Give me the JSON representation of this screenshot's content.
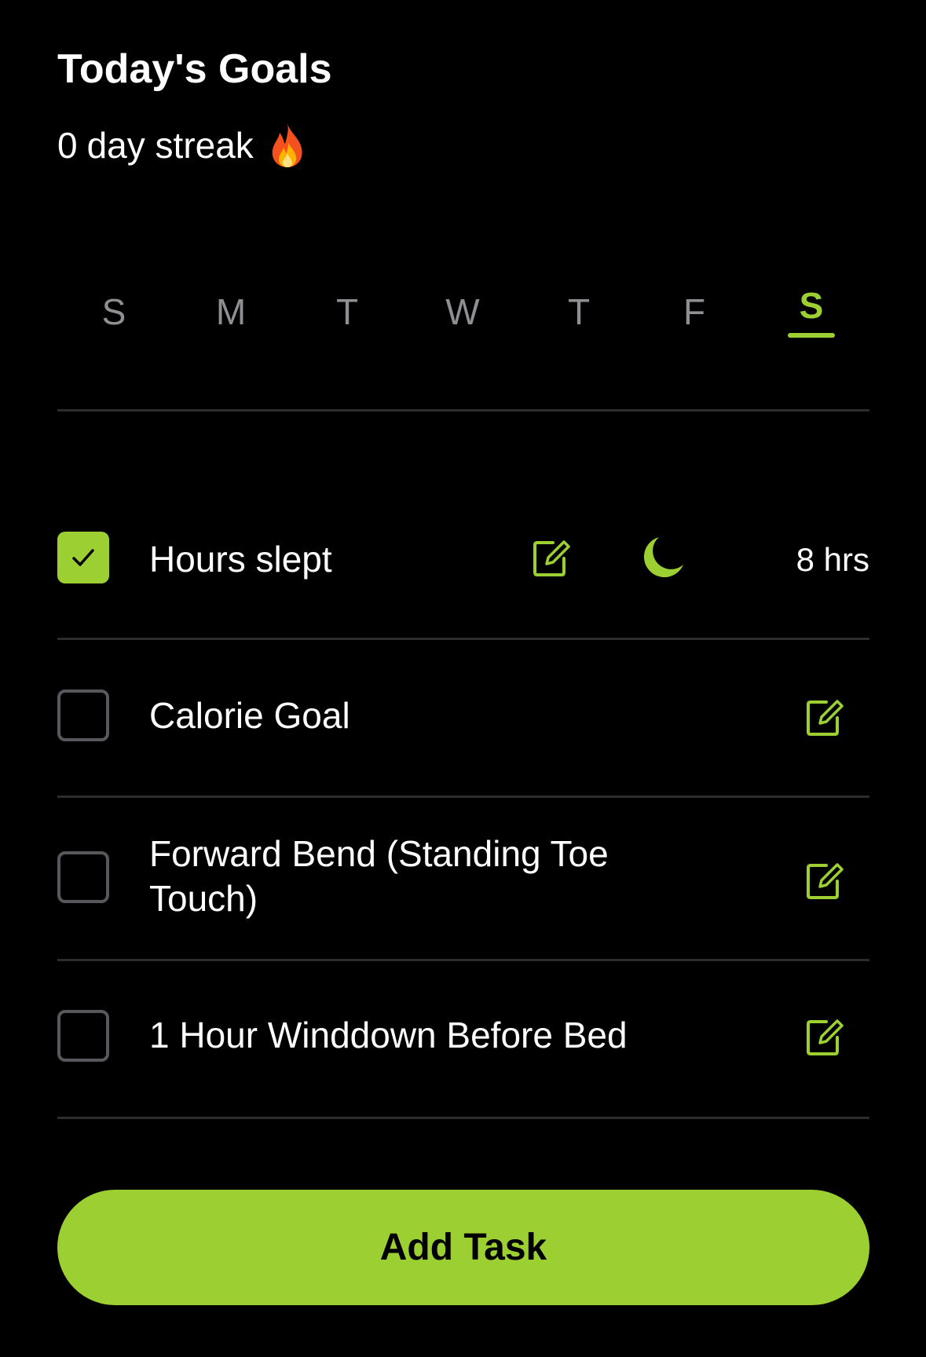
{
  "header": {
    "title": "Today's Goals",
    "streak_count": "0",
    "streak_label": "day streak",
    "streak_icon": "fire-icon"
  },
  "weekdays": {
    "days": [
      "S",
      "M",
      "T",
      "W",
      "T",
      "F",
      "S"
    ],
    "selected_index": 6
  },
  "tasks": [
    {
      "label": "Hours slept",
      "checked": true,
      "icon": "moon-icon",
      "value": "8 hrs"
    },
    {
      "label": "Calorie Goal",
      "checked": false
    },
    {
      "label": "Forward Bend (Standing Toe Touch)",
      "checked": false
    },
    {
      "label": "1 Hour Winddown Before Bed",
      "checked": false
    }
  ],
  "add_button": {
    "label": "Add Task"
  },
  "colors": {
    "accent": "#9ccf31",
    "background": "#000000",
    "inactive_day": "#8e8e93",
    "divider": "#2c2c2e",
    "checkbox_border": "#58585c"
  }
}
